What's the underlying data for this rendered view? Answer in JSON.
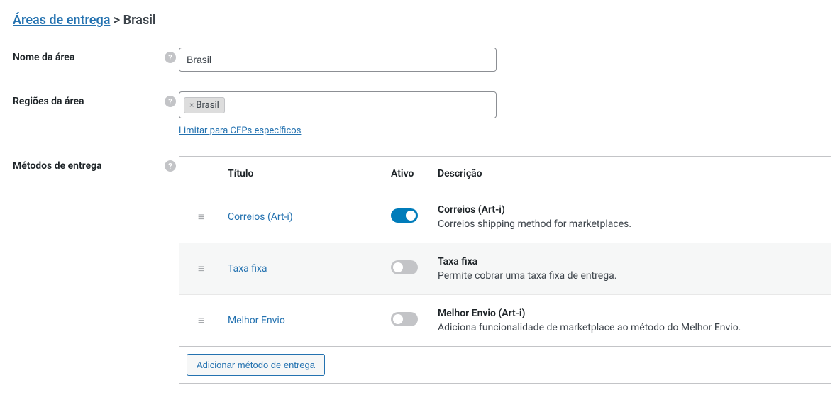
{
  "breadcrumb": {
    "root": "Áreas de entrega",
    "sep": " > ",
    "current": "Brasil"
  },
  "labels": {
    "area_name": "Nome da área",
    "area_regions": "Regiões da área",
    "area_methods": "Métodos de entrega",
    "cep_limit": "Limitar para CEPs específicos"
  },
  "fields": {
    "area_name_value": "Brasil",
    "region_tag": "Brasil"
  },
  "table": {
    "headers": {
      "title": "Título",
      "active": "Ativo",
      "description": "Descrição"
    },
    "rows": [
      {
        "title": "Correios (Art-i)",
        "active": true,
        "desc_title": "Correios (Art-i)",
        "desc_text": "Correios shipping method for marketplaces."
      },
      {
        "title": "Taxa fixa",
        "active": false,
        "desc_title": "Taxa fixa",
        "desc_text": "Permite cobrar uma taxa fixa de entrega."
      },
      {
        "title": "Melhor Envio",
        "active": false,
        "desc_title": "Melhor Envio (Art-i)",
        "desc_text": "Adiciona funcionalidade de marketplace ao método do Melhor Envio."
      }
    ],
    "add_button": "Adicionar método de entrega"
  }
}
